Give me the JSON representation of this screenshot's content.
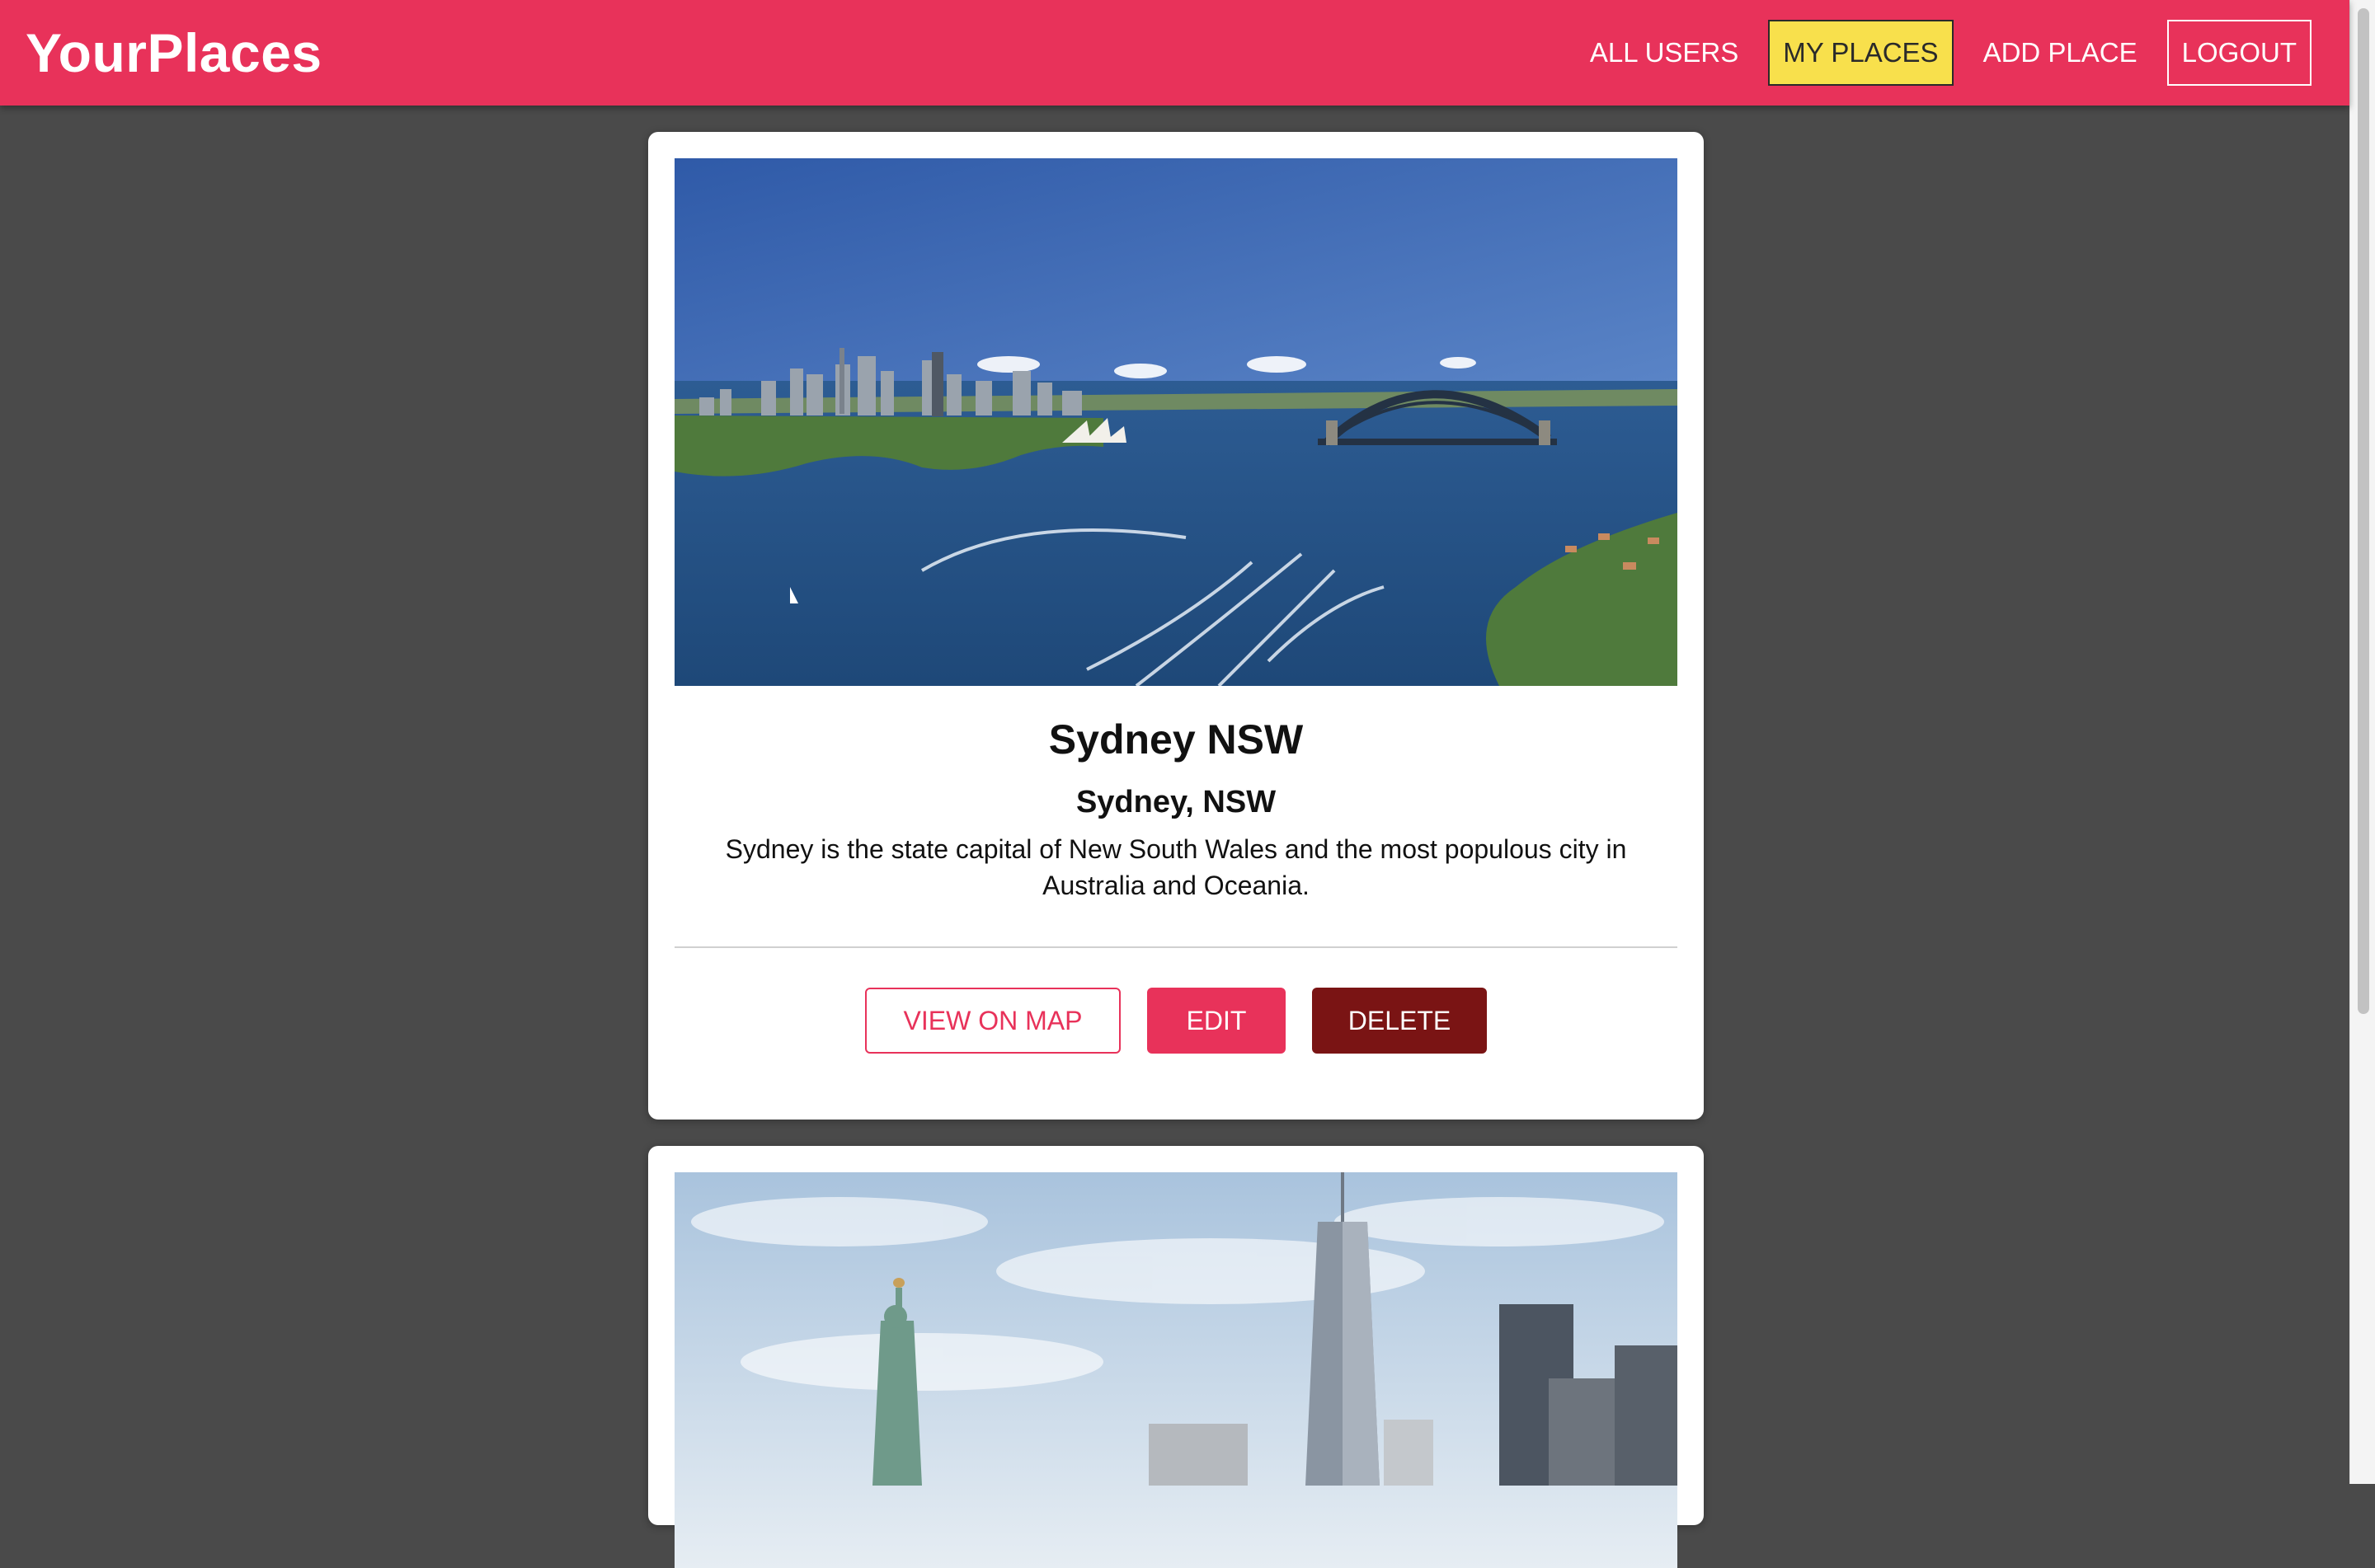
{
  "app": {
    "title": "YourPlaces",
    "accent_color": "#e8325a",
    "active_nav_color": "#f8e04c",
    "danger_color": "#7a1414",
    "background_color": "#4a4a4a"
  },
  "nav": {
    "items": [
      {
        "label": "ALL USERS",
        "active": false,
        "outlined": false
      },
      {
        "label": "MY PLACES",
        "active": true,
        "outlined": false
      },
      {
        "label": "ADD PLACE",
        "active": false,
        "outlined": false
      },
      {
        "label": "LOGOUT",
        "active": false,
        "outlined": true
      }
    ]
  },
  "places": [
    {
      "image": "sydney-harbour-aerial-photo",
      "title": "Sydney NSW",
      "address": "Sydney, NSW",
      "description": "Sydney is the state capital of New South Wales and the most populous city in Australia and Oceania.",
      "actions": {
        "view": "VIEW ON MAP",
        "edit": "EDIT",
        "delete": "DELETE"
      }
    },
    {
      "image": "new-york-skyline-statue-of-liberty-photo"
    }
  ]
}
